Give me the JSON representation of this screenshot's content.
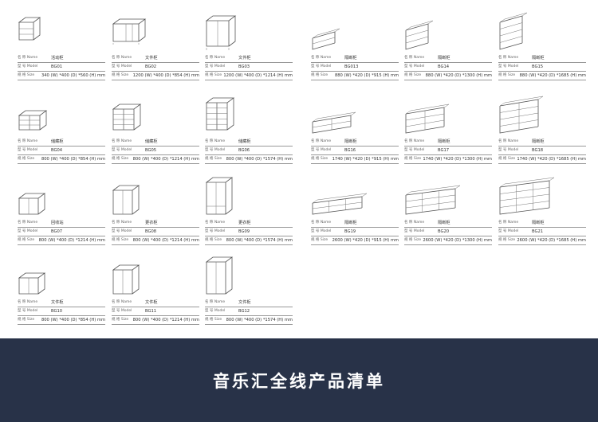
{
  "labels": {
    "name": "名 称 Name",
    "model": "型 号 Model",
    "size": "规 格 Size"
  },
  "products": [
    {
      "name": "活动柜",
      "model": "BG01",
      "size": "340 (W) *400 (D) *560 (H) mm",
      "icon": "mobile-pedestal"
    },
    {
      "name": "文件柜",
      "model": "BG02",
      "size": "1200 (W) *400 (D) *854 (H) mm",
      "icon": "file-cabinet-low"
    },
    {
      "name": "文件柜",
      "model": "BG03",
      "size": "1200 (W) *400 (D) *1214 (H) mm",
      "icon": "file-cabinet-mid"
    },
    {
      "name": "隔断柜",
      "model": "BG013",
      "size": "880 (W) *420 (D) *915 (H) mm",
      "icon": "partition-shelf"
    },
    {
      "name": "隔断柜",
      "model": "BG14",
      "size": "880 (W) *420 (D) *1300 (H) mm",
      "icon": "partition-shelf"
    },
    {
      "name": "隔断柜",
      "model": "BG15",
      "size": "880 (W) *420 (D) *1685 (H) mm",
      "icon": "partition-shelf"
    },
    {
      "name": "储藏柜",
      "model": "BG04",
      "size": "800 (W) *400 (D) *854 (H) mm",
      "icon": "drawer-cabinet"
    },
    {
      "name": "储藏柜",
      "model": "BG05",
      "size": "800 (W) *400 (D) *1214 (H) mm",
      "icon": "drawer-cabinet"
    },
    {
      "name": "储藏柜",
      "model": "BG06",
      "size": "800 (W) *400 (D) *1574 (H) mm",
      "icon": "drawer-cabinet"
    },
    {
      "name": "隔断柜",
      "model": "BG16",
      "size": "1740 (W) *420 (D) *915 (H) mm",
      "icon": "partition-shelf-wide"
    },
    {
      "name": "隔断柜",
      "model": "BG17",
      "size": "1740 (W) *420 (D) *1300 (H) mm",
      "icon": "partition-shelf-wide"
    },
    {
      "name": "隔断柜",
      "model": "BG18",
      "size": "1740 (W) *420 (D) *1685 (H) mm",
      "icon": "partition-shelf-wide"
    },
    {
      "name": "回收站",
      "model": "BG07",
      "size": "800 (W) *400 (D) *1214 (H) mm",
      "icon": "two-door-cabinet"
    },
    {
      "name": "更衣柜",
      "model": "BG08",
      "size": "800 (W) *400 (D) *1214 (H) mm",
      "icon": "two-door-cabinet"
    },
    {
      "name": "更衣柜",
      "model": "BG09",
      "size": "800 (W) *400 (D) *1574 (H) mm",
      "icon": "wardrobe"
    },
    {
      "name": "隔断柜",
      "model": "BG19",
      "size": "2600 (W) *420 (D) *915 (H) mm",
      "icon": "partition-shelf-xwide"
    },
    {
      "name": "隔断柜",
      "model": "BG20",
      "size": "2600 (W) *420 (D) *1300 (H) mm",
      "icon": "partition-shelf-xwide"
    },
    {
      "name": "隔断柜",
      "model": "BG21",
      "size": "2600 (W) *420 (D) *1685 (H) mm",
      "icon": "partition-shelf-xwide"
    },
    {
      "name": "文件柜",
      "model": "BG10",
      "size": "800 (W) *400 (D) *854 (H) mm",
      "icon": "two-door-cabinet"
    },
    {
      "name": "文件柜",
      "model": "BG11",
      "size": "800 (W) *400 (D) *1214 (H) mm",
      "icon": "two-door-cabinet"
    },
    {
      "name": "文件柜",
      "model": "BG12",
      "size": "800 (W) *400 (D) *1574 (H) mm",
      "icon": "two-door-cabinet"
    }
  ],
  "footer": {
    "title": "音乐汇全线产品清单",
    "background": "#283248"
  }
}
